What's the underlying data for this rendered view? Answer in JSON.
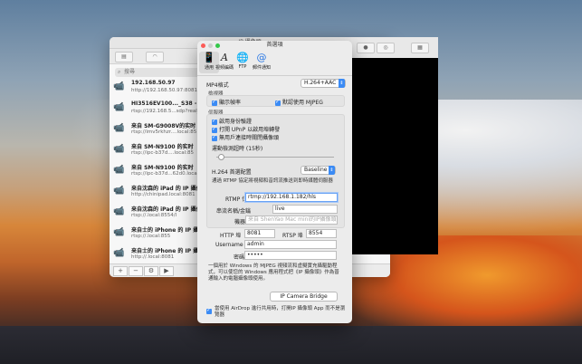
{
  "main_window": {
    "title": "IP 攝像頭",
    "search_placeholder": "搜尋",
    "cameras": [
      {
        "name": "192.168.50.97",
        "url": "http://192.168.50.97:8081"
      },
      {
        "name": "HI3516EV100..._S38 - F",
        "url": "rtsp://192.168.5...sdp?real_s"
      },
      {
        "name": "来自 SM-G9008V的实时",
        "url": "rtsp://imv5rkhzr....local:85"
      },
      {
        "name": "来自 SM-N9100 的实时",
        "url": "rtsp://ipc-b37d....local:85"
      },
      {
        "name": "来自 SM-N9100 的实时",
        "url": "rtsp://ipc-b37d...62d0.local"
      },
      {
        "name": "来自沈森的 iPad 的 IP 攝像",
        "url": "http://chinipad.local:8081"
      },
      {
        "name": "来自沈森的 iPad 的 IP 攝像",
        "url": "rtsp://.local:8554/l"
      },
      {
        "name": "来自士的 iPhone 的 IP 攝像",
        "url": "rtsp://.local:855"
      },
      {
        "name": "来自士的 iPhone 的 IP 攝像",
        "url": "http://.local:8081"
      }
    ],
    "bottom_buttons": [
      "+",
      "−",
      "⚙",
      "▶"
    ]
  },
  "prefs": {
    "title": "首選項",
    "tabs": [
      {
        "label": "通用",
        "icon": "phone-icon"
      },
      {
        "label": "視頻編碼",
        "icon": "text-a-icon"
      },
      {
        "label": "FTP",
        "icon": "globe-icon"
      },
      {
        "label": "郵件通知",
        "icon": "at-icon"
      }
    ],
    "mp4_label": "MP4格式",
    "mp4_value": "H.264+AAC",
    "checker_section": "檢視器",
    "show_framerate": "顯示幀率",
    "default_mjpeg": "默認使用 MJPEG",
    "server_section": "伺服器",
    "enable_auth": "啟用身份驗證",
    "upnp": "打開 UPnP 以啟用埠轉發",
    "no_client_close": "無用戶連接時關閉攝像頭",
    "timeout_label": "運動檢測超時 (15秒)",
    "h264_label": "H.264 首選配置",
    "h264_value": "Baseline",
    "rtmp_desc": "通過 RTMP 協定將視頻和音訊流推送到即時媒體伺服器",
    "rtmp_label": "RTMP 位址",
    "rtmp_value": "rtmp://192.168.1.182/hls",
    "stream_label": "串流名稱/金鑰",
    "stream_value": "live",
    "device_label": "機器",
    "device_placeholder": "来自 ShenYao Mac mini的IP攝像頭",
    "http_label": "HTTP 埠",
    "http_value": "8081",
    "rtsp_label": "RTSP 埠",
    "rtsp_value": "8554",
    "username_label": "Username",
    "username_value": "admin",
    "password_label": "密碼",
    "password_value": "•••••",
    "bridge_desc": "一個用於 Windows 的 MJPEG 視頻流和虛擬實充攝驅動程式，可以使您的 Windows 應用程式把《IP 攝像頭》作為普通輸入的電腦攝像頭使用。",
    "bridge_button": "IP Camera Bridge",
    "airdrop_desc": "當使用 AirDrop 進行共用時，打開IP 攝像頭 App 而不是瀏覽器"
  }
}
